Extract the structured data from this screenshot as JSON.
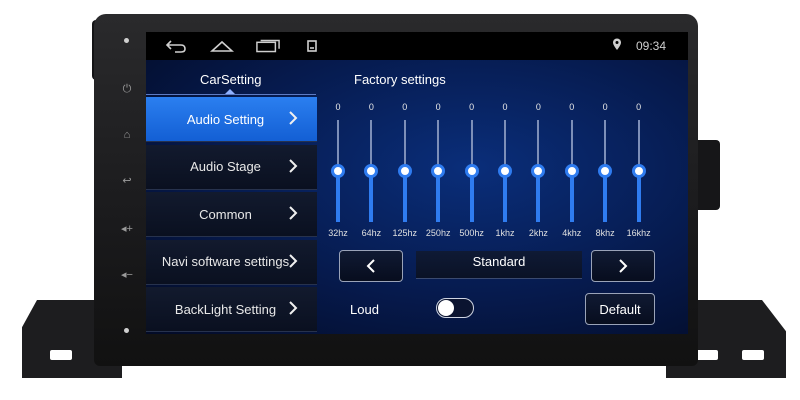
{
  "status": {
    "time": "09:34"
  },
  "header": {
    "left": "CarSetting",
    "right": "Factory settings"
  },
  "menu": {
    "items": [
      {
        "label": "Audio Setting",
        "active": true
      },
      {
        "label": "Audio Stage",
        "active": false
      },
      {
        "label": "Common",
        "active": false
      },
      {
        "label": "Navi software settings",
        "active": false
      },
      {
        "label": "BackLight Setting",
        "active": false
      }
    ]
  },
  "eq": {
    "bands": [
      {
        "freq": "32hz",
        "value": "0"
      },
      {
        "freq": "64hz",
        "value": "0"
      },
      {
        "freq": "125hz",
        "value": "0"
      },
      {
        "freq": "250hz",
        "value": "0"
      },
      {
        "freq": "500hz",
        "value": "0"
      },
      {
        "freq": "1khz",
        "value": "0"
      },
      {
        "freq": "2khz",
        "value": "0"
      },
      {
        "freq": "4khz",
        "value": "0"
      },
      {
        "freq": "8khz",
        "value": "0"
      },
      {
        "freq": "16khz",
        "value": "0"
      }
    ],
    "range": [
      -10,
      10
    ],
    "preset": "Standard"
  },
  "controls": {
    "loud_label": "Loud",
    "loud_on": false,
    "default_label": "Default"
  },
  "colors": {
    "accent": "#2f7cf0",
    "active_menu": "#1f6fe4",
    "screen_bg": "#061a4d"
  },
  "icons": [
    "back-icon",
    "home-icon",
    "recent-apps-icon",
    "notification-icon",
    "location-icon",
    "chevron-right-icon",
    "chevron-left-icon",
    "power-icon"
  ]
}
